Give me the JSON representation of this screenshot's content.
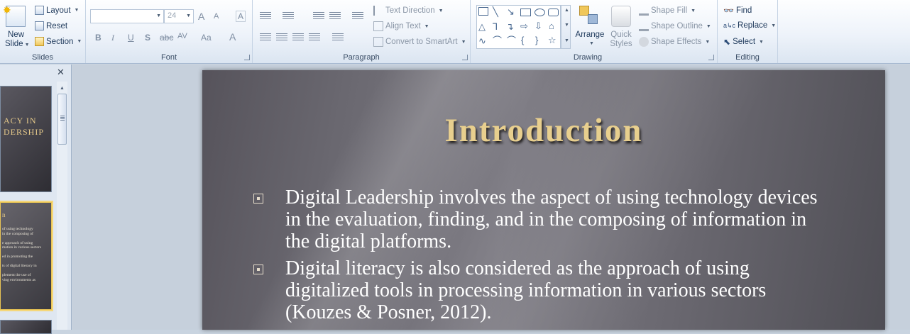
{
  "ribbon": {
    "slides_group": {
      "label": "Slides",
      "new_slide": "New",
      "new_slide2": "Slide",
      "layout": "Layout",
      "reset": "Reset",
      "section": "Section"
    },
    "font_group": {
      "label": "Font",
      "font_name": "",
      "font_size": "24",
      "grow": "A",
      "shrink": "A",
      "clear": "A",
      "bold": "B",
      "italic": "I",
      "underline": "U",
      "shadow": "S",
      "strike": "abc",
      "spacing": "AV",
      "case": "Aa",
      "color": "A"
    },
    "paragraph_group": {
      "label": "Paragraph",
      "text_direction": "Text Direction",
      "align_text": "Align Text",
      "convert_smartart": "Convert to SmartArt"
    },
    "drawing_group": {
      "label": "Drawing",
      "arrange": "Arrange",
      "quick_styles": "Quick",
      "quick_styles2": "Styles",
      "shape_fill": "Shape Fill",
      "shape_outline": "Shape Outline",
      "shape_effects": "Shape Effects"
    },
    "editing_group": {
      "label": "Editing",
      "find": "Find",
      "replace": "Replace",
      "select": "Select"
    }
  },
  "slide_pane": {
    "close": "✕",
    "thumb1_title_line1": "ACY IN",
    "thumb1_title_line2": "DERSHIP",
    "thumb2_heading": "n",
    "thumb2_lines": [
      "of using technology",
      "in the composing of",
      "",
      "e approach of using",
      "mation in various sectors",
      "",
      "ed in promoting the",
      "",
      "ts of digital literacy in",
      "",
      "plement the use of",
      "ving environments as"
    ]
  },
  "slide": {
    "title": "Introduction",
    "bullets": [
      "Digital Leadership involves the aspect of using technology devices in the evaluation, finding, and in the composing of information in the digital platforms.",
      "Digital literacy is also considered as the approach of using digitalized tools in processing information in various sectors (Kouzes & Posner, 2012)."
    ]
  },
  "colors": {
    "title_gold": "#e8cf8e",
    "slide_bg": "#6a6870",
    "selection_outline": "#f5d77a"
  }
}
